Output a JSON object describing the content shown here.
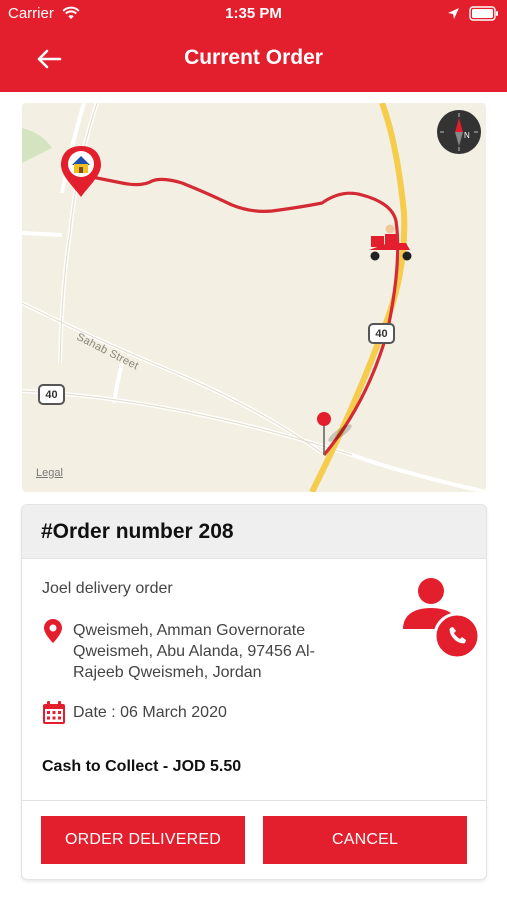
{
  "status_bar": {
    "carrier": "Carrier",
    "time": "1:35 PM",
    "icons": [
      "wifi-icon",
      "location-arrow-icon",
      "battery-icon"
    ]
  },
  "header": {
    "title": "Current Order",
    "back_icon": "arrow-left-icon",
    "background_color": "#e31e2d"
  },
  "map": {
    "street_label": "Sahab Street",
    "road_shields": [
      "40",
      "40"
    ],
    "legal_label": "Legal",
    "compass_label": "N",
    "route_color": "#d42a33",
    "markers": [
      "home-marker-icon",
      "scooter-rider-icon",
      "destination-pin-icon"
    ]
  },
  "order": {
    "title": "#Order number 208",
    "type": "Joel delivery order",
    "address": "Qweismeh, Amman Governorate Qweismeh, Abu Alanda, 97456 Al-Rajeeb Qweismeh, Jordan",
    "date": "Date : 06 March 2020",
    "cash": "Cash to Collect - JOD 5.50",
    "icons": [
      "location-pin-icon",
      "calendar-icon",
      "call-customer-icon"
    ]
  },
  "actions": {
    "delivered_label": "ORDER DELIVERED",
    "cancel_label": "CANCEL",
    "button_color": "#e31e2d"
  }
}
